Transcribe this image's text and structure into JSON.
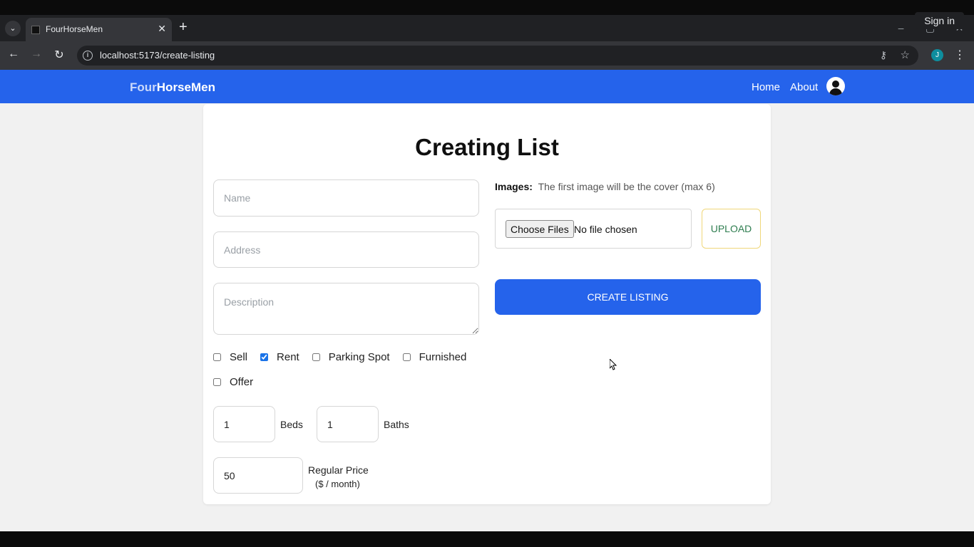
{
  "browser": {
    "tab_title": "FourHorseMen",
    "url": "localhost:5173/create-listing",
    "sign_in_tip": "Sign in",
    "profile_initial": "J"
  },
  "app": {
    "brand_part1": "Four",
    "brand_part2": "HorseMen",
    "nav": {
      "home": "Home",
      "about": "About"
    }
  },
  "form": {
    "title": "Creating List",
    "name_placeholder": "Name",
    "address_placeholder": "Address",
    "description_placeholder": "Description",
    "checkboxes": [
      {
        "label": "Sell",
        "checked": false
      },
      {
        "label": "Rent",
        "checked": true
      },
      {
        "label": "Parking Spot",
        "checked": false
      },
      {
        "label": "Furnished",
        "checked": false
      },
      {
        "label": "Offer",
        "checked": false
      }
    ],
    "beds_value": "1",
    "beds_label": "Beds",
    "baths_value": "1",
    "baths_label": "Baths",
    "price_value": "50",
    "price_label": "Regular Price",
    "price_unit": "($ / month)",
    "images_label": "Images:",
    "images_hint": "The first image will be the cover (max 6)",
    "choose_files": "Choose Files",
    "no_file": "No file chosen",
    "upload": "UPLOAD",
    "create": "CREATE LISTING"
  },
  "colors": {
    "accent": "#2563eb",
    "upload_border": "#f0d77a",
    "upload_text": "#2e7d4f"
  }
}
